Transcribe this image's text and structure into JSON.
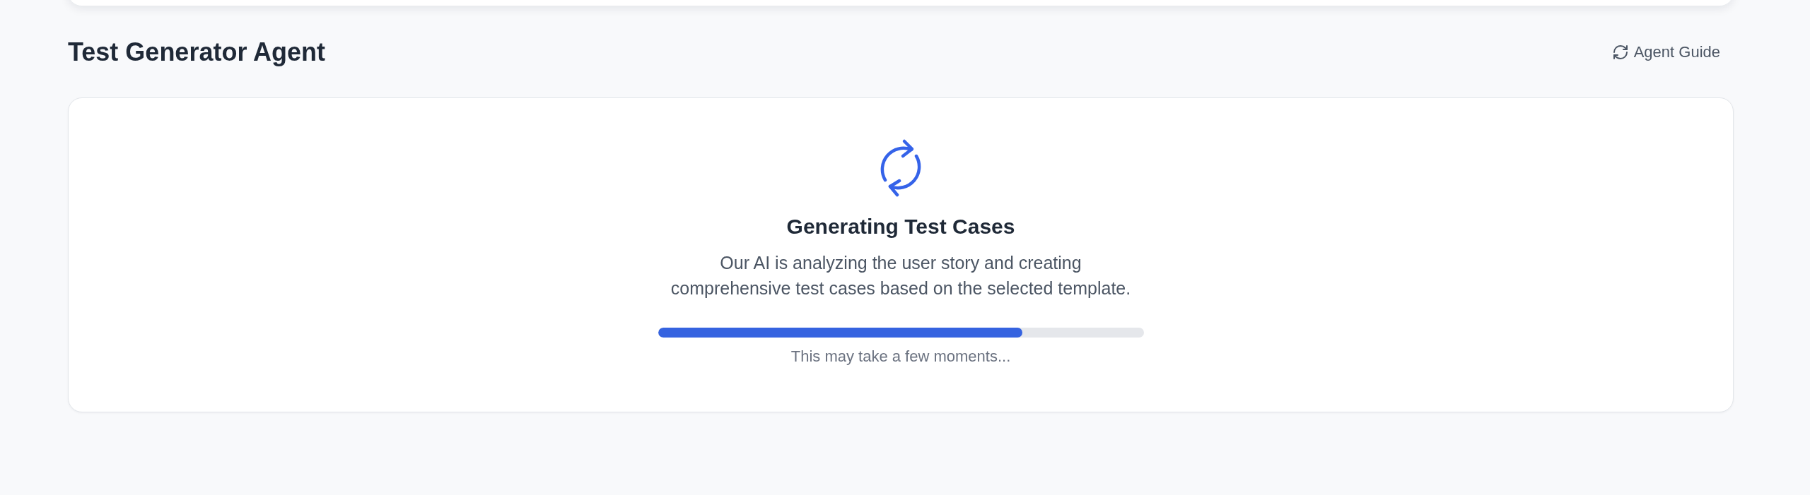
{
  "header": {
    "title": "Test Generator Agent",
    "guide_button": {
      "label": "Agent Guide"
    }
  },
  "status_card": {
    "heading": "Generating Test Cases",
    "description": "Our AI is analyzing the user story and creating comprehensive test cases based on the selected template.",
    "progress": {
      "level": 0.75
    },
    "note": "This may take a few moments..."
  }
}
